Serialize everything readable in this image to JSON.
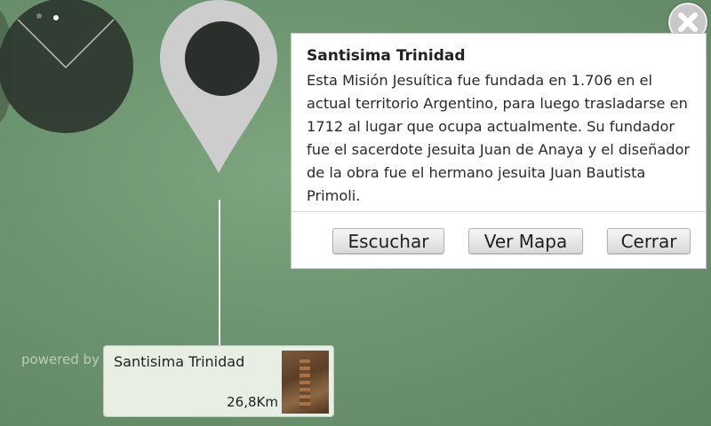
{
  "icons": {
    "radar": "radar-icon",
    "pin": "map-pin-icon",
    "close": "close-icon",
    "thumbnail": "church-ruins-thumbnail"
  },
  "info": {
    "title": "Santisima Trinidad",
    "description": "Esta Misión Jesuítica fue fundada en 1.706 en el actual territorio Argentino, para luego trasladarse en 1712 al lugar que ocupa actualmente. Su fundador fue el sacerdote jesuita Juan de Anaya y el diseñador de la obra fue el hermano jesuita Juan Bautista Primoli.",
    "buttons": {
      "listen": "Escuchar",
      "map": "Ver Mapa",
      "close": "Cerrar"
    }
  },
  "powered_by": "powered by",
  "poi": {
    "name": "Santisima Trinidad",
    "distance": "26,8Km"
  },
  "colors": {
    "background": "#6d9470",
    "radar": "#2f3a30",
    "panel": "#ffffff",
    "card": "#e9eee4"
  }
}
